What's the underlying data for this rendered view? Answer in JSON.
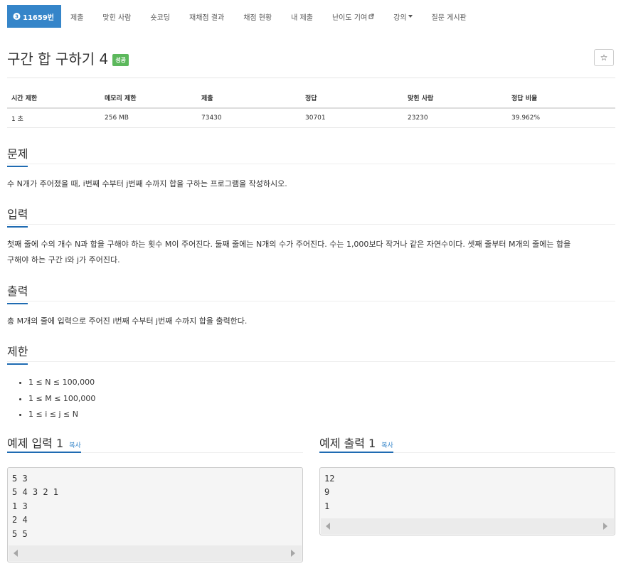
{
  "nav": {
    "problem_number": "11659번",
    "items": [
      "제출",
      "맞힌 사람",
      "숏코딩",
      "재채점 결과",
      "채점 현황",
      "내 제출",
      "난이도 기여",
      "강의"
    ],
    "after": "질문 게시판"
  },
  "problem": {
    "title": "구간 합 구하기 4",
    "result_badge": "성공",
    "star": "☆"
  },
  "info": {
    "headers": [
      "시간 제한",
      "메모리 제한",
      "제출",
      "정답",
      "맞힌 사람",
      "정답 비율"
    ],
    "values": [
      "1 초",
      "256 MB",
      "73430",
      "30701",
      "23230",
      "39.962%"
    ]
  },
  "sections": {
    "description_title": "문제",
    "description": "수 N개가 주어졌을 때, i번째 수부터 j번째 수까지 합을 구하는 프로그램을 작성하시오.",
    "input_title": "입력",
    "input_line1": "첫째 줄에 수의 개수 N과 합을 구해야 하는 횟수 M이 주어진다. 둘째 줄에는 N개의 수가 주어진다. 수는 1,000보다 작거나 같은 자연수이다. 셋째 줄부터 M개의 줄에는 합을",
    "input_line2": "구해야 하는 구간 i와 j가 주어진다.",
    "output_title": "출력",
    "output": "총 M개의 줄에 입력으로 주어진 i번째 수부터 j번째 수까지 합을 출력한다.",
    "limits_title": "제한",
    "limits": [
      "1 ≤ N ≤ 100,000",
      "1 ≤ M ≤ 100,000",
      "1 ≤ i ≤ j ≤ N"
    ]
  },
  "examples": {
    "input_title": "예제 입력 1",
    "output_title": "예제 출력 1",
    "copy_label": "복사",
    "input_lines": [
      "5 3",
      "5 4 3 2 1",
      "1 3",
      "2 4",
      "5 5"
    ],
    "output_lines": [
      "12",
      "9",
      "1"
    ]
  },
  "colors": {
    "primary": "#3585c9",
    "success": "#5cb85c",
    "section_underline": "#1f6bb2"
  }
}
